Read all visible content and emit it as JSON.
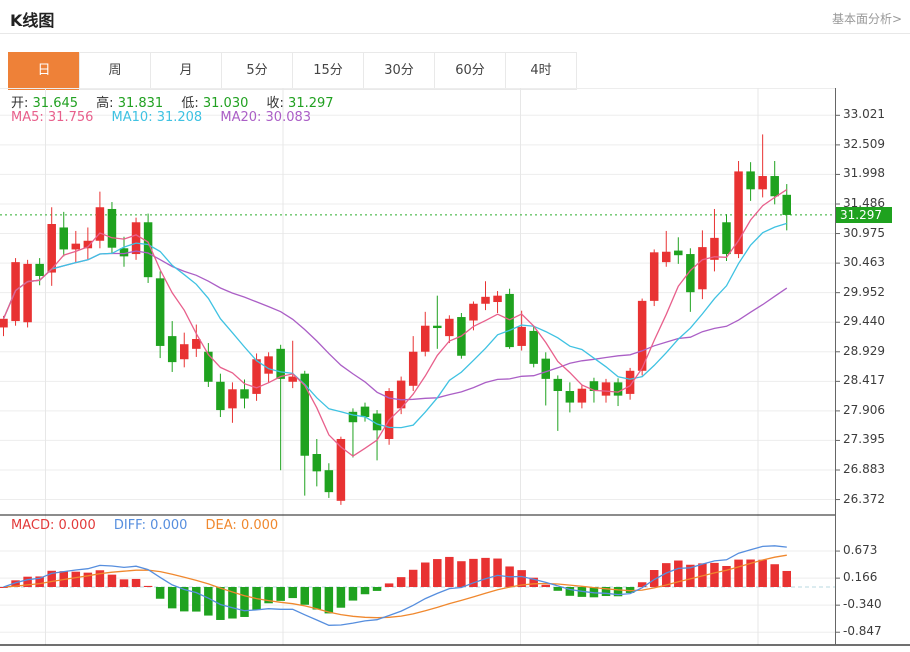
{
  "header": {
    "title": "K线图",
    "link": "基本面分析>"
  },
  "tabs": {
    "items": [
      "日",
      "周",
      "月",
      "5分",
      "15分",
      "30分",
      "60分",
      "4时"
    ],
    "active_index": 0
  },
  "ohlc_row": {
    "o_label": "开:",
    "o": "31.645",
    "h_label": "高:",
    "h": "31.831",
    "l_label": "低:",
    "l": "31.030",
    "c_label": "收:",
    "c": "31.297"
  },
  "ma_row": {
    "ma5_label": "MA5:",
    "ma5": "31.756",
    "ma10_label": "MA10:",
    "ma10": "31.208",
    "ma20_label": "MA20:",
    "ma20": "30.083"
  },
  "macd_row": {
    "macd_label": "MACD:",
    "macd": "0.000",
    "diff_label": "DIFF:",
    "diff": "0.000",
    "dea_label": "DEA:",
    "dea": "0.000"
  },
  "price_badge": "31.297",
  "colors": {
    "up": "#e83232",
    "down": "#1fa21f",
    "ma5": "#e8608c",
    "ma10": "#3fc2e2",
    "ma20": "#ab5fc6",
    "diff": "#568ede",
    "dea": "#f0882e",
    "macd_label": "#e23a3a",
    "badge": "#1fa21f",
    "tab_active": "#ee8138",
    "grid": "#ededed",
    "vgrid": "#e7e7e7",
    "axis": "#666666",
    "last_price_line": "#2fae2f",
    "zero_dash": "#b9d8e2",
    "ohlc_value": "#21a121"
  },
  "chart_data": {
    "type": "candlestick+macd",
    "price_axis_ticks": [
      33.021,
      32.509,
      31.998,
      31.486,
      30.975,
      30.463,
      29.952,
      29.44,
      28.929,
      28.417,
      27.906,
      27.395,
      26.883,
      26.372
    ],
    "macd_axis_ticks": [
      0.673,
      0.166,
      -0.34,
      -0.847
    ],
    "last_price": 31.297,
    "indicators": {
      "ma_periods": [
        5,
        10,
        20
      ],
      "macd": {
        "fast": 12,
        "slow": 26,
        "signal": 9
      }
    },
    "candles": [
      [
        29.35,
        29.55,
        29.2,
        29.5
      ],
      [
        29.46,
        30.55,
        29.38,
        30.48
      ],
      [
        29.44,
        30.52,
        29.35,
        30.45
      ],
      [
        30.45,
        30.55,
        30.08,
        30.24
      ],
      [
        30.3,
        31.43,
        30.07,
        31.14
      ],
      [
        31.08,
        31.35,
        30.58,
        30.7
      ],
      [
        30.7,
        31.02,
        30.48,
        30.8
      ],
      [
        30.72,
        31.08,
        30.52,
        30.85
      ],
      [
        30.85,
        31.7,
        30.72,
        31.43
      ],
      [
        31.4,
        31.52,
        30.62,
        30.73
      ],
      [
        30.72,
        30.92,
        30.4,
        30.58
      ],
      [
        30.62,
        31.25,
        30.52,
        31.17
      ],
      [
        31.17,
        31.32,
        30.12,
        30.22
      ],
      [
        30.2,
        30.32,
        28.82,
        29.03
      ],
      [
        29.2,
        29.46,
        28.58,
        28.75
      ],
      [
        28.8,
        29.26,
        28.66,
        29.06
      ],
      [
        28.98,
        29.4,
        28.84,
        29.15
      ],
      [
        28.93,
        29.08,
        28.32,
        28.41
      ],
      [
        28.41,
        28.55,
        27.8,
        27.92
      ],
      [
        27.95,
        28.4,
        27.7,
        28.28
      ],
      [
        28.28,
        28.45,
        27.95,
        28.12
      ],
      [
        28.2,
        28.9,
        28.08,
        28.8
      ],
      [
        28.55,
        28.92,
        28.4,
        28.85
      ],
      [
        28.98,
        29.05,
        26.88,
        28.46
      ],
      [
        28.41,
        29.12,
        28.3,
        28.5
      ],
      [
        28.55,
        28.6,
        26.44,
        27.13
      ],
      [
        27.16,
        27.42,
        26.6,
        26.86
      ],
      [
        26.88,
        27.0,
        26.4,
        26.5
      ],
      [
        26.35,
        27.46,
        26.28,
        27.42
      ],
      [
        27.89,
        27.95,
        27.1,
        27.71
      ],
      [
        27.98,
        28.05,
        27.72,
        27.8
      ],
      [
        27.86,
        27.92,
        27.05,
        27.57
      ],
      [
        27.42,
        28.3,
        27.32,
        28.25
      ],
      [
        27.95,
        28.5,
        27.85,
        28.43
      ],
      [
        28.34,
        29.2,
        28.25,
        28.93
      ],
      [
        28.93,
        29.62,
        28.85,
        29.38
      ],
      [
        29.38,
        29.9,
        28.98,
        29.34
      ],
      [
        29.2,
        29.56,
        29.08,
        29.5
      ],
      [
        29.53,
        29.6,
        28.81,
        28.86
      ],
      [
        29.47,
        29.8,
        29.3,
        29.76
      ],
      [
        29.76,
        30.15,
        29.65,
        29.88
      ],
      [
        29.79,
        29.98,
        29.6,
        29.9
      ],
      [
        29.93,
        30.02,
        28.98,
        29.01
      ],
      [
        29.03,
        29.64,
        28.95,
        29.36
      ],
      [
        29.29,
        29.38,
        28.66,
        28.72
      ],
      [
        28.81,
        28.92,
        28.0,
        28.46
      ],
      [
        28.46,
        28.52,
        27.56,
        28.25
      ],
      [
        28.25,
        28.4,
        27.88,
        28.05
      ],
      [
        28.05,
        28.35,
        27.95,
        28.29
      ],
      [
        28.42,
        28.48,
        28.05,
        28.25
      ],
      [
        28.17,
        28.46,
        28.05,
        28.4
      ],
      [
        28.4,
        28.47,
        27.99,
        28.17
      ],
      [
        28.2,
        28.65,
        28.1,
        28.6
      ],
      [
        28.6,
        29.85,
        28.52,
        29.81
      ],
      [
        29.81,
        30.7,
        29.72,
        30.65
      ],
      [
        30.48,
        31.02,
        30.4,
        30.66
      ],
      [
        30.68,
        30.91,
        30.45,
        30.6
      ],
      [
        30.62,
        30.72,
        29.62,
        29.96
      ],
      [
        30.01,
        31.03,
        29.84,
        30.74
      ],
      [
        30.52,
        31.4,
        30.32,
        30.9
      ],
      [
        31.17,
        31.31,
        30.5,
        30.62
      ],
      [
        30.62,
        32.23,
        30.55,
        32.05
      ],
      [
        32.05,
        32.21,
        31.54,
        31.74
      ],
      [
        31.74,
        32.69,
        31.6,
        31.97
      ],
      [
        31.97,
        32.23,
        31.48,
        31.62
      ],
      [
        31.645,
        31.831,
        31.03,
        31.297
      ]
    ]
  }
}
